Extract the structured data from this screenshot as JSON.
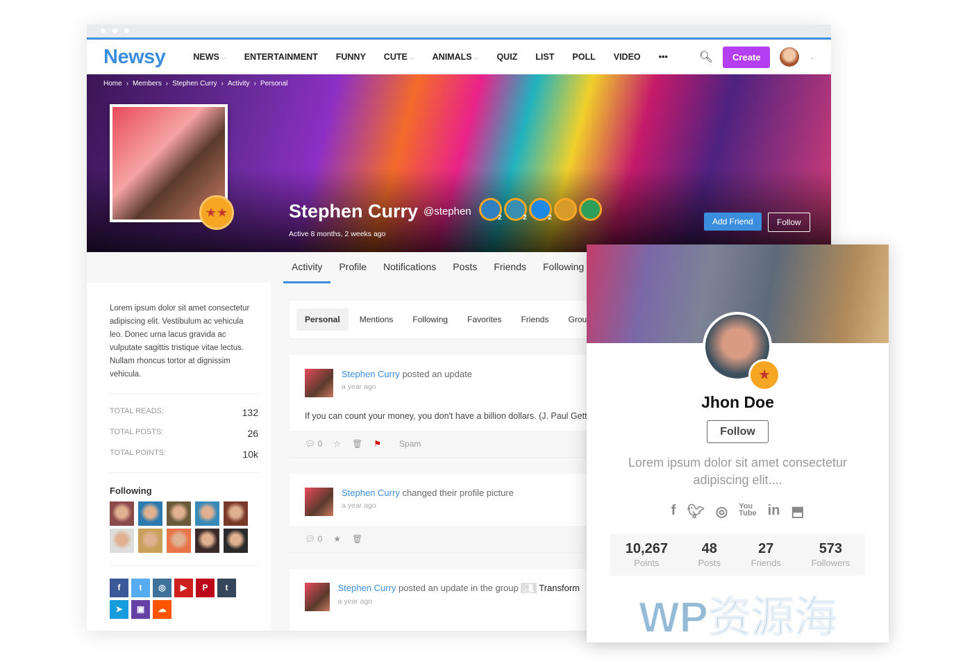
{
  "nav": {
    "logo": "Newsy",
    "items": [
      {
        "label": "NEWS",
        "dropdown": true
      },
      {
        "label": "ENTERTAINMENT"
      },
      {
        "label": "FUNNY"
      },
      {
        "label": "CUTE",
        "dropdown": true
      },
      {
        "label": "ANIMALS",
        "dropdown": true
      },
      {
        "label": "QUIZ"
      },
      {
        "label": "LIST"
      },
      {
        "label": "POLL"
      },
      {
        "label": "VIDEO"
      },
      {
        "label": "•••"
      }
    ],
    "create": "Create",
    "accent": "#b43ef1",
    "brand": "#3b8ede"
  },
  "breadcrumb": [
    "Home",
    "Members",
    "Stephen Curry",
    "Activity",
    "Personal"
  ],
  "profile": {
    "name": "Stephen Curry",
    "handle": "@stephen",
    "active": "Active 8 months, 2 weeks ago",
    "add_friend": "Add Friend",
    "follow": "Follow",
    "badges": [
      {
        "color": "#2f7fc1",
        "count": "2"
      },
      {
        "color": "#3a8fb0",
        "count": "2"
      },
      {
        "color": "#1e88e5",
        "count": "2"
      },
      {
        "color": "#d89b2a",
        "count": ""
      },
      {
        "color": "#2e9e5b",
        "count": ""
      }
    ]
  },
  "tabs": [
    "Activity",
    "Profile",
    "Notifications",
    "Posts",
    "Friends",
    "Following"
  ],
  "sidebar": {
    "bio": "Lorem ipsum dolor sit amet consectetur adipiscing elit. Vestibulum ac vehicula leo. Donec urna lacus gravida ac vulputate sagittis tristique vitae lectus. Nullam rhoncus tortor at dignissim vehicula.",
    "stats": [
      {
        "label": "TOTAL READS:",
        "value": "132"
      },
      {
        "label": "TOTAL POSTS:",
        "value": "26"
      },
      {
        "label": "TOTAL POINTS:",
        "value": "10k"
      }
    ],
    "following_title": "Following",
    "social": [
      {
        "icon": "facebook-icon",
        "glyph": "f",
        "color": "#3b5998"
      },
      {
        "icon": "twitter-icon",
        "glyph": "t",
        "color": "#55acee"
      },
      {
        "icon": "instagram-icon",
        "glyph": "◎",
        "color": "#3f729b"
      },
      {
        "icon": "youtube-icon",
        "glyph": "▶",
        "color": "#cd201f"
      },
      {
        "icon": "pinterest-icon",
        "glyph": "P",
        "color": "#bd081c"
      },
      {
        "icon": "tumblr-icon",
        "glyph": "t",
        "color": "#35465c"
      },
      {
        "icon": "telegram-icon",
        "glyph": "➤",
        "color": "#179cde"
      },
      {
        "icon": "twitch-icon",
        "glyph": "▣",
        "color": "#6441a5"
      },
      {
        "icon": "soundcloud-icon",
        "glyph": "☁",
        "color": "#ff5500"
      }
    ]
  },
  "subtabs": [
    "Personal",
    "Mentions",
    "Following",
    "Favorites",
    "Friends",
    "Groups"
  ],
  "posts": [
    {
      "author": "Stephen Curry",
      "action": "posted an update",
      "time": "a year ago",
      "body": "If you can count your money, you don't have a billion dollars. (J. Paul Getty)",
      "comments": "0",
      "spam": "Spam"
    },
    {
      "author": "Stephen Curry",
      "action": "changed their profile picture",
      "time": "a year ago",
      "comments": "0"
    },
    {
      "author": "Stephen Curry",
      "action": "posted an update in the group",
      "group": "Transform",
      "time": "a year ago"
    }
  ],
  "card": {
    "name": "Jhon Doe",
    "follow": "Follow",
    "desc": "Lorem ipsum dolor sit amet consectetur adipiscing elit....",
    "icons": [
      "facebook-icon",
      "twitter-icon",
      "instagram-icon",
      "youtube-icon",
      "linkedin-icon",
      "twitch-icon"
    ],
    "stats": [
      {
        "value": "10,267",
        "label": "Points"
      },
      {
        "value": "48",
        "label": "Posts"
      },
      {
        "value": "27",
        "label": "Friends"
      },
      {
        "value": "573",
        "label": "Followers"
      }
    ]
  },
  "watermark": "WP资源海"
}
